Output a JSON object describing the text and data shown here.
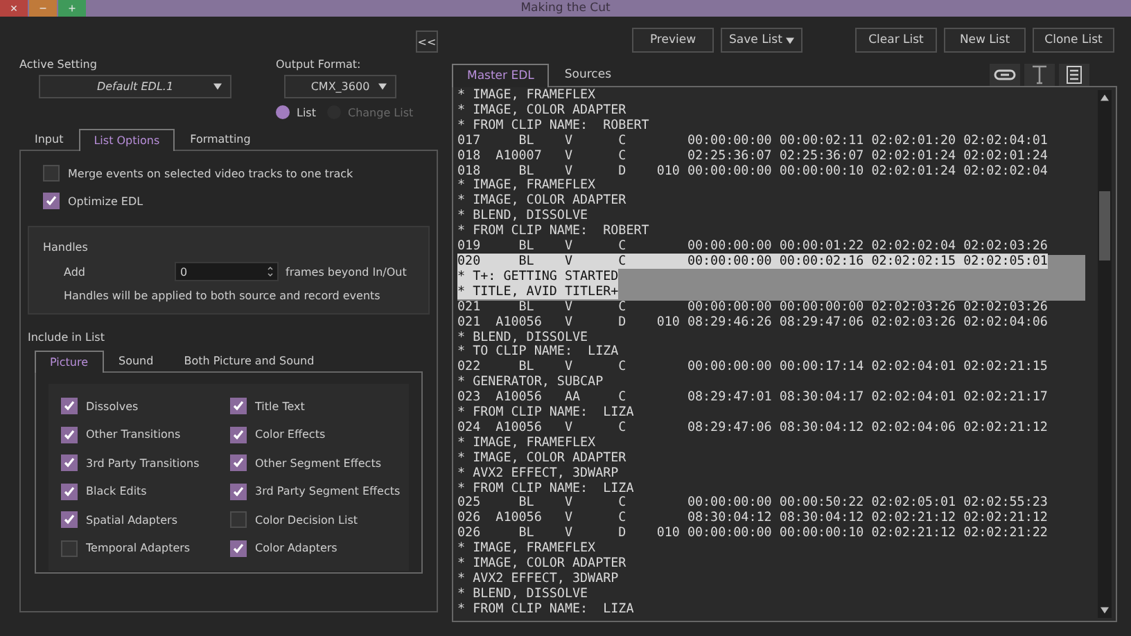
{
  "window": {
    "title": "Making the Cut",
    "controls": [
      {
        "kind": "close",
        "glyph": "×"
      },
      {
        "kind": "minimize",
        "glyph": "−"
      },
      {
        "kind": "maximize",
        "glyph": "+"
      }
    ]
  },
  "collapse_button": "<<",
  "active_setting": {
    "label": "Active Setting",
    "value": "Default EDL.1"
  },
  "output_format": {
    "label": "Output Format:",
    "value": "CMX_3600"
  },
  "list_type": [
    {
      "label": "List",
      "selected": true
    },
    {
      "label": "Change List",
      "selected": false
    }
  ],
  "settings_tabs": [
    {
      "label": "Input",
      "selected": false
    },
    {
      "label": "List Options",
      "selected": true
    },
    {
      "label": "Formatting",
      "selected": false
    }
  ],
  "options": [
    {
      "label": "Merge events on selected video tracks to one track",
      "checked": false
    },
    {
      "label": "Optimize EDL",
      "checked": true
    }
  ],
  "handles": {
    "title": "Handles",
    "add_label": "Add",
    "value": "0",
    "suffix": "frames beyond In/Out",
    "note": "Handles will be applied to both source and record events"
  },
  "include": {
    "title": "Include in List",
    "tabs": [
      {
        "label": "Picture",
        "selected": true
      },
      {
        "label": "Sound",
        "selected": false
      },
      {
        "label": "Both Picture and Sound",
        "selected": false
      }
    ],
    "items": [
      {
        "label": "Dissolves",
        "checked": true
      },
      {
        "label": "Title Text",
        "checked": true
      },
      {
        "label": "Other Transitions",
        "checked": true
      },
      {
        "label": "Color Effects",
        "checked": true
      },
      {
        "label": "3rd Party Transitions",
        "checked": true
      },
      {
        "label": "Other Segment Effects",
        "checked": true
      },
      {
        "label": "Black Edits",
        "checked": true
      },
      {
        "label": "3rd Party Segment Effects",
        "checked": true
      },
      {
        "label": "Spatial Adapters",
        "checked": true
      },
      {
        "label": "Color Decision List",
        "checked": false
      },
      {
        "label": "Temporal Adapters",
        "checked": false
      },
      {
        "label": "Color Adapters",
        "checked": true
      }
    ]
  },
  "toolbar": [
    {
      "label": "Preview",
      "kind": "button"
    },
    {
      "label": "Save List",
      "kind": "dropdown"
    },
    {
      "label": "Clear List",
      "kind": "button"
    },
    {
      "label": "New List",
      "kind": "button"
    },
    {
      "label": "Clone List",
      "kind": "button"
    }
  ],
  "edl_tabs": [
    {
      "label": "Master EDL",
      "selected": true
    },
    {
      "label": "Sources",
      "selected": false
    }
  ],
  "edl_lines": [
    {
      "text": "* IMAGE, FRAMEFLEX",
      "selected": false
    },
    {
      "text": "* IMAGE, COLOR ADAPTER",
      "selected": false
    },
    {
      "text": "* FROM CLIP NAME:  ROBERT",
      "selected": false
    },
    {
      "text": "017     BL    V      C        00:00:00:00 00:00:02:11 02:02:01:20 02:02:04:01",
      "selected": false
    },
    {
      "text": "018  A10007   V      C        02:25:36:07 02:25:36:07 02:02:01:24 02:02:01:24",
      "selected": false
    },
    {
      "text": "018     BL    V      D    010 00:00:00:00 00:00:00:10 02:02:01:24 02:02:02:04",
      "selected": false
    },
    {
      "text": "* IMAGE, FRAMEFLEX",
      "selected": false
    },
    {
      "text": "* IMAGE, COLOR ADAPTER",
      "selected": false
    },
    {
      "text": "* BLEND, DISSOLVE",
      "selected": false
    },
    {
      "text": "* FROM CLIP NAME:  ROBERT",
      "selected": false
    },
    {
      "text": "019     BL    V      C        00:00:00:00 00:00:01:22 02:02:02:04 02:02:03:26",
      "selected": false
    },
    {
      "text": "020     BL    V      C        00:00:00:00 00:00:02:16 02:02:02:15 02:02:05:01",
      "selected": true
    },
    {
      "text": "* T+: GETTING STARTED",
      "selected": true
    },
    {
      "text": "* TITLE, AVID TITLER+",
      "selected": true
    },
    {
      "text": "021     BL    V      C        00:00:00:00 00:00:00:00 02:02:03:26 02:02:03:26",
      "selected": false
    },
    {
      "text": "021  A10056   V      D    010 08:29:46:26 08:29:47:06 02:02:03:26 02:02:04:06",
      "selected": false
    },
    {
      "text": "* BLEND, DISSOLVE",
      "selected": false
    },
    {
      "text": "* TO CLIP NAME:  LIZA",
      "selected": false
    },
    {
      "text": "022     BL    V      C        00:00:00:00 00:00:17:14 02:02:04:01 02:02:21:15",
      "selected": false
    },
    {
      "text": "* GENERATOR, SUBCAP",
      "selected": false
    },
    {
      "text": "023  A10056   AA     C        08:29:47:01 08:30:04:17 02:02:04:01 02:02:21:17",
      "selected": false
    },
    {
      "text": "* FROM CLIP NAME:  LIZA",
      "selected": false
    },
    {
      "text": "024  A10056   V      C        08:29:47:06 08:30:04:12 02:02:04:06 02:02:21:12",
      "selected": false
    },
    {
      "text": "* IMAGE, FRAMEFLEX",
      "selected": false
    },
    {
      "text": "* IMAGE, COLOR ADAPTER",
      "selected": false
    },
    {
      "text": "* AVX2 EFFECT, 3DWARP",
      "selected": false
    },
    {
      "text": "* FROM CLIP NAME:  LIZA",
      "selected": false
    },
    {
      "text": "025     BL    V      C        00:00:00:00 00:00:50:22 02:02:05:01 02:02:55:23",
      "selected": false
    },
    {
      "text": "026  A10056   V      C        08:30:04:12 08:30:04:12 02:02:21:12 02:02:21:12",
      "selected": false
    },
    {
      "text": "026     BL    V      D    010 00:00:00:00 00:00:00:10 02:02:21:12 02:02:21:22",
      "selected": false
    },
    {
      "text": "* IMAGE, FRAMEFLEX",
      "selected": false
    },
    {
      "text": "* IMAGE, COLOR ADAPTER",
      "selected": false
    },
    {
      "text": "* AVX2 EFFECT, 3DWARP",
      "selected": false
    },
    {
      "text": "* BLEND, DISSOLVE",
      "selected": false
    },
    {
      "text": "* FROM CLIP NAME:  LIZA",
      "selected": false
    }
  ]
}
